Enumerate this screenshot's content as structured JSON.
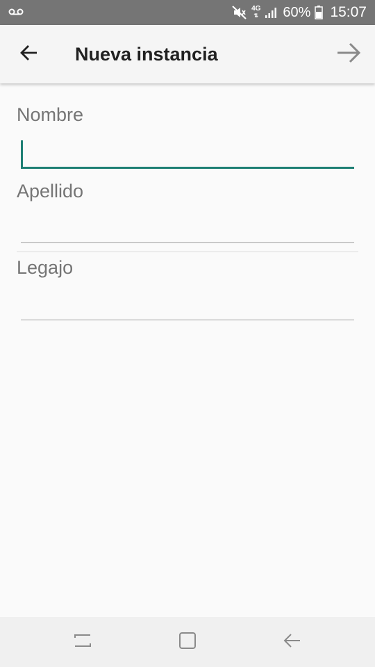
{
  "status_bar": {
    "voicemail_icon": "voicemail-icon",
    "mute_icon": "mute-icon",
    "network_type": "4G",
    "signal_icon": "signal-icon",
    "battery_percent": "60%",
    "battery_icon": "battery-icon",
    "time": "15:07",
    "background_color": "#757575"
  },
  "app_bar": {
    "title": "Nueva instancia",
    "back_icon": "arrow-left-icon",
    "next_icon": "arrow-right-icon"
  },
  "form": {
    "fields": [
      {
        "label": "Nombre",
        "value": "",
        "focused": true
      },
      {
        "label": "Apellido",
        "value": "",
        "focused": false
      },
      {
        "label": "Legajo",
        "value": "",
        "focused": false
      }
    ],
    "accent_color": "#1e7f74"
  },
  "nav_bar": {
    "recents_icon": "recents-icon",
    "home_icon": "home-icon",
    "back_icon": "nav-back-icon"
  }
}
